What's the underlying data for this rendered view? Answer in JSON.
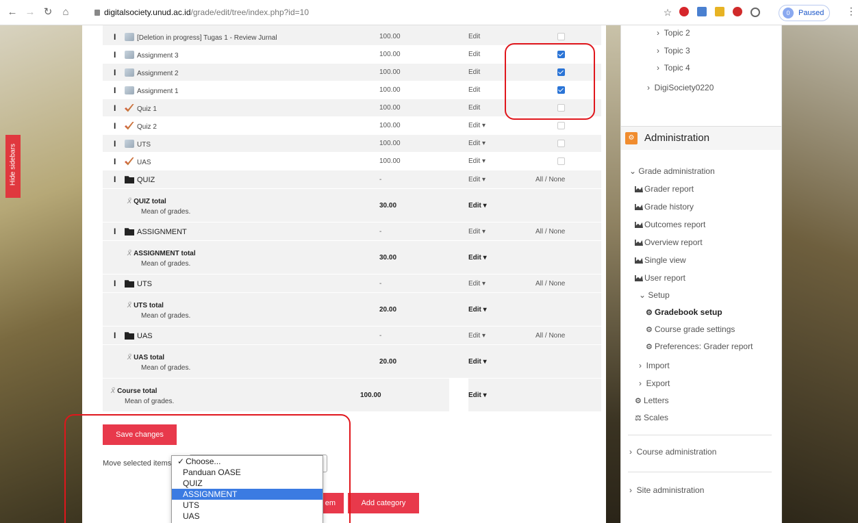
{
  "browser": {
    "url_host": "digitalsociety.unud.ac.id",
    "url_path": "/grade/edit/tree/index.php?id=10",
    "profile_status": "Paused",
    "profile_initial": "0"
  },
  "sidebar_toggle": "Hide sidebars",
  "grade_table": {
    "rows": [
      {
        "type": "item",
        "icon": "assignment-icon",
        "name": "[Deletion in progress] Tugas 1 - Review Jurnal",
        "max": "100.00",
        "edit": "Edit",
        "checked": false
      },
      {
        "type": "item",
        "icon": "assignment-icon",
        "name": "Assignment 3",
        "max": "100.00",
        "edit": "Edit",
        "checked": true
      },
      {
        "type": "item",
        "icon": "assignment-icon",
        "name": "Assignment 2",
        "max": "100.00",
        "edit": "Edit",
        "checked": true
      },
      {
        "type": "item",
        "icon": "assignment-icon",
        "name": "Assignment 1",
        "max": "100.00",
        "edit": "Edit",
        "checked": true
      },
      {
        "type": "item",
        "icon": "quiz-icon",
        "name": "Quiz 1",
        "max": "100.00",
        "edit": "Edit",
        "checked": false
      },
      {
        "type": "item",
        "icon": "quiz-icon",
        "name": "Quiz 2",
        "max": "100.00",
        "edit": "Edit ▾",
        "checked": false
      },
      {
        "type": "item",
        "icon": "assignment-icon",
        "name": "UTS",
        "max": "100.00",
        "edit": "Edit ▾",
        "checked": false
      },
      {
        "type": "item",
        "icon": "quiz-icon",
        "name": "UAS",
        "max": "100.00",
        "edit": "Edit ▾",
        "checked": false
      },
      {
        "type": "category",
        "name": "QUIZ",
        "max": "-",
        "edit": "Edit ▾",
        "select": "All / None"
      },
      {
        "type": "total",
        "name": "QUIZ total",
        "desc": "Mean of grades.",
        "max": "30.00",
        "edit": "Edit ▾"
      },
      {
        "type": "category",
        "name": "ASSIGNMENT",
        "max": "-",
        "edit": "Edit ▾",
        "select": "All / None"
      },
      {
        "type": "total",
        "name": "ASSIGNMENT total",
        "desc": "Mean of grades.",
        "max": "30.00",
        "edit": "Edit ▾"
      },
      {
        "type": "category",
        "name": "UTS",
        "max": "-",
        "edit": "Edit ▾",
        "select": "All / None"
      },
      {
        "type": "total",
        "name": "UTS total",
        "desc": "Mean of grades.",
        "max": "20.00",
        "edit": "Edit ▾"
      },
      {
        "type": "category",
        "name": "UAS",
        "max": "-",
        "edit": "Edit ▾",
        "select": "All / None"
      },
      {
        "type": "total",
        "name": "UAS total",
        "desc": "Mean of grades.",
        "max": "20.00",
        "edit": "Edit ▾"
      },
      {
        "type": "course",
        "name": "Course total",
        "desc": "Mean of grades.",
        "max": "100.00",
        "edit": "Edit ▾"
      }
    ]
  },
  "controls": {
    "save_label": "Save changes",
    "move_label": "Move selected items to",
    "add_grade_label": "em",
    "add_category_label": "Add category"
  },
  "dropdown": {
    "options": [
      "Choose...",
      "Panduan OASE",
      "QUIZ",
      "ASSIGNMENT",
      "UTS",
      "UAS"
    ],
    "selected_marker": "✓",
    "highlighted": "ASSIGNMENT"
  },
  "nav": {
    "items": [
      "Topic 2",
      "Topic 3",
      "Topic 4",
      "DigiSociety0220"
    ]
  },
  "admin": {
    "title": "Administration",
    "grade_admin": "Grade administration",
    "reports": [
      "Grader report",
      "Grade history",
      "Outcomes report",
      "Overview report",
      "Single view",
      "User report"
    ],
    "setup": "Setup",
    "setup_items": [
      "Gradebook setup",
      "Course grade settings",
      "Preferences: Grader report"
    ],
    "import": "Import",
    "export": "Export",
    "letters": "Letters",
    "scales": "Scales",
    "course_admin": "Course administration",
    "site_admin": "Site administration"
  },
  "colors": {
    "accent": "#e8394b",
    "highlight": "#3b7be2",
    "annotation": "#e0161c",
    "admin_icon": "#f08c2e"
  }
}
